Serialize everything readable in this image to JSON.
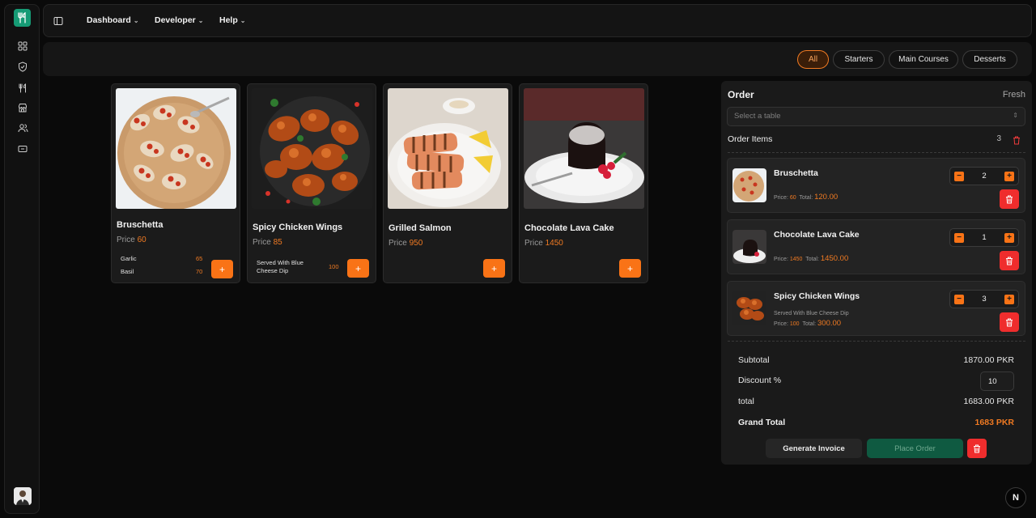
{
  "nav": {
    "menus": [
      "Dashboard",
      "Developer",
      "Help"
    ],
    "rail_icons": [
      "grid-icon",
      "shield-icon",
      "utensils-icon",
      "store-icon",
      "users-icon",
      "ticket-icon"
    ]
  },
  "categories": [
    {
      "label": "All",
      "active": true
    },
    {
      "label": "Starters",
      "active": false
    },
    {
      "label": "Main Courses",
      "active": false
    },
    {
      "label": "Desserts",
      "active": false
    }
  ],
  "products": [
    {
      "name": "Bruschetta",
      "price_label": "Price",
      "price": "60",
      "addons": [
        {
          "name": "Garlic",
          "price": "65"
        },
        {
          "name": "Basil",
          "price": "70"
        }
      ],
      "add_label": "+"
    },
    {
      "name": "Spicy Chicken Wings",
      "price_label": "Price",
      "price": "85",
      "addons": [
        {
          "name": "Served With Blue Cheese Dip",
          "price": "100"
        }
      ],
      "add_label": "+"
    },
    {
      "name": "Grilled Salmon",
      "price_label": "Price",
      "price": "950",
      "addons": [],
      "add_label": "+"
    },
    {
      "name": "Chocolate Lava Cake",
      "price_label": "Price",
      "price": "1450",
      "addons": [],
      "add_label": "+"
    }
  ],
  "order": {
    "title": "Order",
    "status": "Fresh",
    "table_placeholder": "Select a table",
    "items_label": "Order Items",
    "items_count": "3",
    "price_label": "Price:",
    "total_label": "Total:",
    "items": [
      {
        "name": "Bruschetta",
        "note": "",
        "qty": "2",
        "price": "60",
        "total": "120.00"
      },
      {
        "name": "Chocolate Lava Cake",
        "note": "",
        "qty": "1",
        "price": "1450",
        "total": "1450.00"
      },
      {
        "name": "Spicy Chicken Wings",
        "note": "Served With Blue Cheese Dip",
        "qty": "3",
        "price": "100",
        "total": "300.00"
      }
    ],
    "summary": {
      "subtotal_label": "Subtotal",
      "subtotal": "1870.00 PKR",
      "discount_label": "Discount %",
      "discount": "10",
      "total_label": "total",
      "total": "1683.00 PKR",
      "grand_label": "Grand Total",
      "grand": "1683 PKR"
    },
    "buttons": {
      "invoice": "Generate Invoice",
      "place": "Place Order"
    }
  },
  "badge": "N",
  "colors": {
    "accent": "#f97316",
    "brand": "#169b75",
    "danger": "#ef2d2d",
    "place_order": "#0f5a41"
  }
}
